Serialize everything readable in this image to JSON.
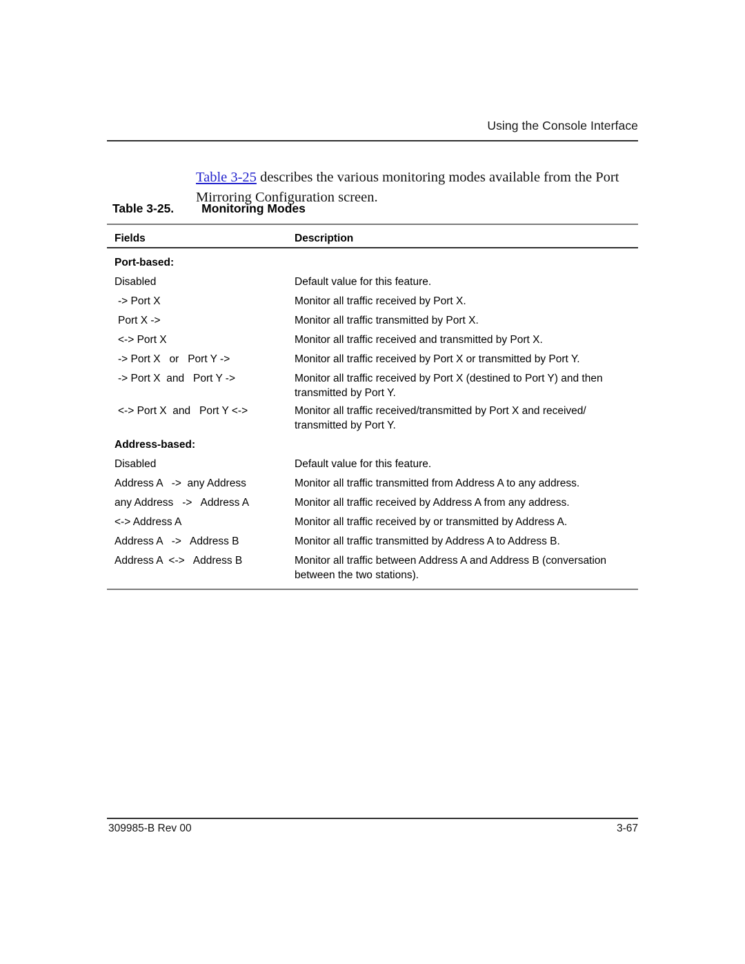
{
  "header": {
    "running_title": "Using the Console Interface"
  },
  "intro": {
    "link_text": "Table 3-25",
    "rest_text": " describes the various monitoring modes available from the Port Mirroring Configuration screen."
  },
  "table": {
    "number_label": "Table 3-25.",
    "caption": "Monitoring Modes",
    "columns": [
      "Fields",
      "Description"
    ],
    "rows": [
      {
        "kind": "section",
        "field": "Port-based:",
        "desc": ""
      },
      {
        "kind": "data",
        "field": "Disabled",
        "desc": "Default value for this feature."
      },
      {
        "kind": "data",
        "indent": true,
        "field": "-> Port X",
        "desc": "Monitor all traffic received by Port X."
      },
      {
        "kind": "data",
        "indent": true,
        "field": "Port X ->",
        "desc": "Monitor all traffic transmitted by Port X."
      },
      {
        "kind": "data",
        "indent": true,
        "field": "<-> Port X",
        "desc": "Monitor all traffic received and transmitted by Port X."
      },
      {
        "kind": "data",
        "indent": true,
        "field": "-> Port X   or   Port Y ->",
        "desc": "Monitor all traffic received by Port X or transmitted by Port Y."
      },
      {
        "kind": "data",
        "indent": true,
        "field": "-> Port X  and   Port Y ->",
        "desc": "Monitor all traffic received by Port X (destined to Port Y) and then transmitted by Port Y."
      },
      {
        "kind": "data",
        "indent": true,
        "field": "<-> Port X  and   Port Y <->",
        "desc": "Monitor all traffic received/transmitted by Port X and received/ transmitted by Port Y."
      },
      {
        "kind": "section",
        "field": "Address-based:",
        "desc": ""
      },
      {
        "kind": "data",
        "field": "Disabled",
        "desc": "Default value for this feature."
      },
      {
        "kind": "data",
        "field": "Address A   ->  any Address",
        "desc": "Monitor all traffic transmitted from Address A to any address."
      },
      {
        "kind": "data",
        "field": "any Address   ->   Address A",
        "desc": "Monitor all traffic received by Address A from any address."
      },
      {
        "kind": "data",
        "field": "<-> Address A",
        "desc": "Monitor all traffic received by or transmitted by Address A."
      },
      {
        "kind": "data",
        "field": "Address A   ->   Address B",
        "desc": "Monitor all traffic transmitted by Address A to Address B."
      },
      {
        "kind": "data",
        "field": "Address A  <->   Address B",
        "desc": "Monitor all traffic between Address A and Address B (conversation between the two stations)."
      }
    ]
  },
  "footer": {
    "document_id": "309985-B Rev 00",
    "page_number": "3-67"
  },
  "colors": {
    "link": "#2222cc",
    "rule_gray": "#7a7a7a",
    "rule_dark": "#2e2e2e",
    "text": "#000000"
  }
}
